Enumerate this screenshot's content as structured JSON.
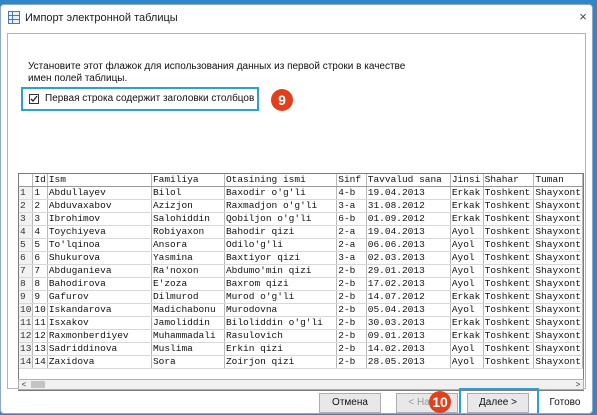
{
  "window": {
    "title": "Импорт электронной таблицы",
    "close_glyph": "×"
  },
  "instruction": "Установите этот флажок для использования данных из первой строки в качестве имен полей таблицы.",
  "header_checkbox": {
    "label": "Первая строка содержит заголовки столбцов",
    "checked": true
  },
  "badges": {
    "step9": "9",
    "step10": "10"
  },
  "grid": {
    "columns": [
      "Id",
      "Ism",
      "Familiya",
      "Otasining ismi",
      "Sinf",
      "Tavvalud sana",
      "Jinsi",
      "Shahar",
      "Tuman"
    ],
    "rows": [
      {
        "n": "1",
        "cells": [
          "1",
          "Abdullayev",
          "Bilol",
          "Baxodir o'g'li",
          "4-b",
          "19.04.2013",
          "Erkak",
          "Toshkent",
          "Shayxont"
        ]
      },
      {
        "n": "2",
        "cells": [
          "2",
          "Abduvaxabov",
          "Azizjon",
          "Raxmadjon o'g'li",
          "3-a",
          "31.08.2012",
          "Erkak",
          "Toshkent",
          "Shayxont"
        ]
      },
      {
        "n": "3",
        "cells": [
          "3",
          "Ibrohimov",
          "Salohiddin",
          "Qobiljon o'g'li",
          "6-b",
          "01.09.2012",
          "Erkak",
          "Toshkent",
          "Shayxont"
        ]
      },
      {
        "n": "4",
        "cells": [
          "4",
          "Toychiyeva",
          "Robiyaxon",
          "Bahodir qizi",
          "2-a",
          "19.04.2013",
          "Ayol",
          "Toshkent",
          "Shayxont"
        ]
      },
      {
        "n": "5",
        "cells": [
          "5",
          "To'lqinoa",
          "Ansora",
          "Odilo'g'li",
          "2-a",
          "06.06.2013",
          "Ayol",
          "Toshkent",
          "Shayxont"
        ]
      },
      {
        "n": "6",
        "cells": [
          "6",
          "Shukurova",
          "Yasmina",
          "Baxtiyor qizi",
          "3-a",
          "02.03.2013",
          "Ayol",
          "Toshkent",
          "Shayxont"
        ]
      },
      {
        "n": "7",
        "cells": [
          "7",
          "Abduganieva",
          "Ra'noxon",
          "Abdumo'min qizi",
          "2-b",
          "29.01.2013",
          "Ayol",
          "Toshkent",
          "Shayxont"
        ]
      },
      {
        "n": "8",
        "cells": [
          "8",
          "Bahodirova",
          "E'zoza",
          "Baxrom qizi",
          "2-b",
          "17.02.2013",
          "Ayol",
          "Toshkent",
          "Shayxont"
        ]
      },
      {
        "n": "9",
        "cells": [
          "9",
          "Gafurov",
          "Dilmurod",
          "Murod o'g'li",
          "2-b",
          "14.07.2012",
          "Erkak",
          "Toshkent",
          "Shayxont"
        ]
      },
      {
        "n": "10",
        "cells": [
          "10",
          "Iskandarova",
          "Madichabonu",
          "Murodovna",
          "2-b",
          "05.04.2013",
          "Ayol",
          "Toshkent",
          "Shayxont"
        ]
      },
      {
        "n": "11",
        "cells": [
          "11",
          "Isxakov",
          "Jamoliddin",
          "Biloliddin o'g'li",
          "2-b",
          "30.03.2013",
          "Erkak",
          "Toshkent",
          "Shayxont"
        ]
      },
      {
        "n": "12",
        "cells": [
          "12",
          "Raxmonberdiyev",
          "Muhammadali",
          "Rasulovich",
          "2-b",
          "09.01.2013",
          "Erkak",
          "Toshkent",
          "Shayxont"
        ]
      },
      {
        "n": "13",
        "cells": [
          "13",
          "Sadriddinova",
          "Muslima",
          "Erkin qizi",
          "2-b",
          "14.02.2013",
          "Ayol",
          "Toshkent",
          "Shayxont"
        ]
      },
      {
        "n": "14",
        "cells": [
          "14",
          "Zaxidova",
          "Sora",
          "Zoirjon qizi",
          "2-b",
          "28.05.2013",
          "Ayol",
          "Toshkent",
          "Shayxont"
        ]
      }
    ]
  },
  "scroll": {
    "left": "<",
    "right": ">"
  },
  "buttons": {
    "cancel": "Отмена",
    "back": "< Назад",
    "next": "Далее >",
    "finish": "Готово"
  },
  "colors": {
    "highlight": "#2aa0d8",
    "badge": "#e0401c",
    "background": "#2f86c8"
  }
}
